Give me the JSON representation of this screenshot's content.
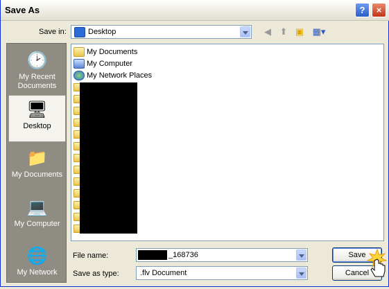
{
  "window": {
    "title": "Save As",
    "help_glyph": "?",
    "close_glyph": "×"
  },
  "toolbar": {
    "save_in_label": "Save in:",
    "save_in_value": "Desktop",
    "icons": [
      "back-icon",
      "up-folder-icon",
      "new-folder-icon",
      "view-menu-icon"
    ]
  },
  "places": [
    {
      "label": "My Recent Documents",
      "icon": "recent-documents-icon",
      "selected": false
    },
    {
      "label": "Desktop",
      "icon": "desktop-icon",
      "selected": true
    },
    {
      "label": "My Documents",
      "icon": "my-documents-icon",
      "selected": false
    },
    {
      "label": "My Computer",
      "icon": "my-computer-icon",
      "selected": false
    },
    {
      "label": "My Network",
      "icon": "my-network-icon",
      "selected": false
    }
  ],
  "files": [
    {
      "name": "My Documents",
      "icon": "my-documents-icon"
    },
    {
      "name": "My Computer",
      "icon": "my-computer-icon"
    },
    {
      "name": "My Network Places",
      "icon": "network-places-icon"
    }
  ],
  "filename": {
    "label": "File name:",
    "value": "_168736"
  },
  "filetype": {
    "label": "Save as type:",
    "value": ".flv Document"
  },
  "buttons": {
    "save": "Save",
    "cancel": "Cancel"
  },
  "colors": {
    "title_close": "#c2351a",
    "title_help": "#2c5ec8",
    "places_bg": "#8e8c83",
    "dialog_bg": "#ece9d8"
  }
}
